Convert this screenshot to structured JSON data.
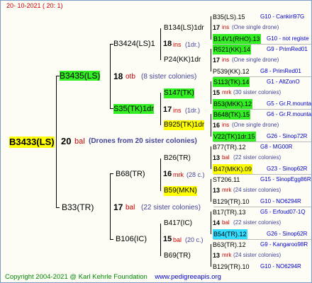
{
  "date": "20- 10-2021 ( 20:  1)",
  "root": {
    "id": "B3433(LS)",
    "count": "20",
    "unit": "bal",
    "note": "(Drones from 20 sister colonies)"
  },
  "gen1": [
    {
      "id": "B3435(LS)",
      "count": "18",
      "unit": "otb",
      "note": "(8 sister colonies)"
    },
    {
      "id": "B33(TR)",
      "count": "17",
      "unit": "bal",
      "note": "(22 sister colonies)"
    }
  ],
  "gen2": [
    {
      "id": "B3424(LS)1",
      "count": "18",
      "unit": "ins",
      "note": "(1dr.)"
    },
    {
      "id": "S35(TK)1dr",
      "count": "17",
      "unit": "ins",
      "note": "(1dr.)"
    },
    {
      "id": "B68(TR)",
      "count": "16",
      "unit": "mrk",
      "note": "(28 c.)"
    },
    {
      "id": "B106(IC)",
      "count": "15",
      "unit": "bal",
      "note": "(20 c.)"
    }
  ],
  "gen3": [
    {
      "id": "B134(LS)1dr"
    },
    {
      "id": "P24(KK)1dr"
    },
    {
      "id": "S147(TK)"
    },
    {
      "id": "B925(TK)1dr"
    },
    {
      "id": "B26(TR)"
    },
    {
      "id": "B59(MKN)"
    },
    {
      "id": "B417(IC)"
    },
    {
      "id": "B69(TR)"
    }
  ],
  "gen4": [
    {
      "l": "B35(LS).15",
      "r": "G10 - Cankiri97G"
    },
    {
      "n": "17",
      "u": "ins",
      "note": "(One single drone)"
    },
    {
      "l": "B14V1(RHO).13",
      "r": "G10 - not registe"
    },
    {
      "l": "R521(KK).14",
      "r": "G9 - PrimRed01"
    },
    {
      "n": "17",
      "u": "ins",
      "note": "(One single drone)"
    },
    {
      "l": "P539(KK).12",
      "r": "G8 - PrimRed01"
    },
    {
      "l": "S113(TK).14",
      "r": "G1 - AltZonO"
    },
    {
      "n": "15",
      "u": "mrk",
      "note": "(30 sister colonies)"
    },
    {
      "l": "B53(MKK).12",
      "r": "G5 - Gr.R.mounta"
    },
    {
      "l": "B648(TK).15",
      "r": "G6 - Gr.R.mounta"
    },
    {
      "n": "16",
      "u": "ins",
      "note": "(One single drone)"
    },
    {
      "l": "V22(TK)1dr.15",
      "r": "G26 - Sinop72R"
    },
    {
      "l": "B77(TR).12",
      "r": "G8 - MG00R"
    },
    {
      "n": "13",
      "u": "bal",
      "note": "(22 sister colonies)"
    },
    {
      "l": "B47(MKK).09",
      "r": "G23 - Sinop62R"
    },
    {
      "l": "ST206.11",
      "r": "G15 - SinopEgg86R"
    },
    {
      "n": "13",
      "u": "mrk",
      "note": "(24 sister colonies)"
    },
    {
      "l": "B129(TR).10",
      "r": "G10 - NO6294R"
    },
    {
      "l": "B17(TR).13",
      "r": "G5 - Erfoud07-1Q"
    },
    {
      "n": "14",
      "u": "bal",
      "note": "(22 sister colonies)"
    },
    {
      "l": "B54(TR).12",
      "r": "G26 - Sinop62R"
    },
    {
      "l": "B63(TR).12",
      "r": "G9 - Kangaroo98R"
    },
    {
      "n": "13",
      "u": "mrk",
      "note": "(24 sister colonies)"
    },
    {
      "l": "B129(TR).10",
      "r": "G10 - NO6294R"
    }
  ],
  "footer": {
    "copyright": "Copyright 2004-2021 @ Karl Kehrle Foundation",
    "site": "www.pedigreeapis.org"
  }
}
